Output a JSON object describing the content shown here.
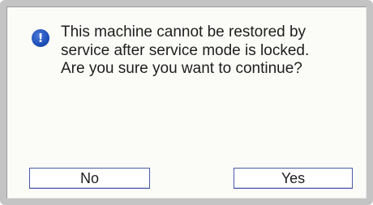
{
  "dialog": {
    "icon": "info-icon",
    "icon_glyph": "!",
    "message_lines": [
      "This machine cannot be restored by",
      "service after service mode is locked.",
      "Are you sure you want to continue?"
    ],
    "buttons": {
      "no_label": "No",
      "yes_label": "Yes"
    }
  },
  "colors": {
    "frame": "#c4c4c4",
    "dialog_background": "#fbfbf8",
    "icon_blue": "#1f4fb8",
    "button_border": "#4a5aa8"
  }
}
